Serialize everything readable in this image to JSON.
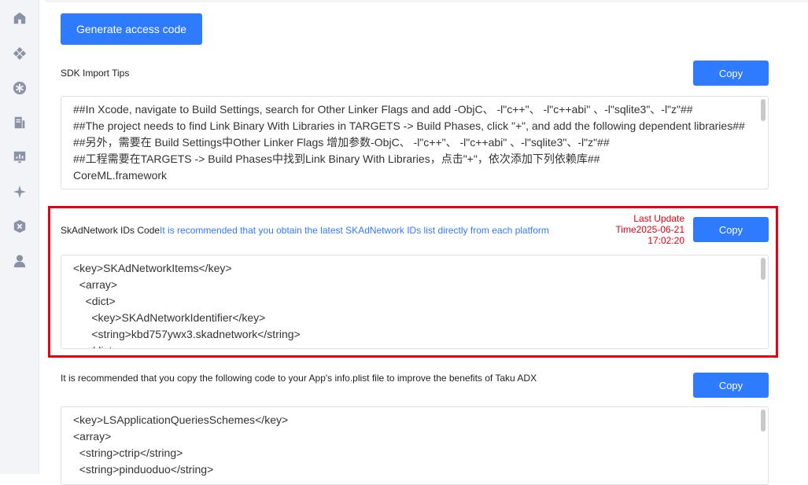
{
  "sidebar": {
    "icons": [
      "home-icon",
      "apps-icon",
      "asterisk-icon",
      "report-icon",
      "chart-icon",
      "sparkle-icon",
      "shield-icon",
      "user-icon"
    ]
  },
  "generate_button": "Generate access code",
  "sdk_tips": {
    "label": "SDK Import Tips",
    "copy": "Copy",
    "code": "##In Xcode, navigate to Build Settings, search for Other Linker Flags and add -ObjC、 -l\"c++\"、 -l\"c++abi\" 、-l\"sqlite3\"、-l\"z\"##\n##The project needs to find Link Binary With Libraries in TARGETS -> Build Phases, click \"+\", and add the following dependent libraries##\n##另外，需要在 Build Settings中Other Linker Flags 增加参数-ObjC、 -l\"c++\"、 -l\"c++abi\" 、-l\"sqlite3\"、-l\"z\"##\n##工程需要在TARGETS -> Build Phases中找到Link Binary With Libraries，点击\"+\"，依次添加下列依赖库##\nCoreML.framework"
  },
  "skadnetwork": {
    "label": "SkAdNetwork IDs Code",
    "hint": "It is recommended that you obtain the latest SKAdNetwork IDs list directly from each platform",
    "last_update_line1": "Last Update",
    "last_update_line2": "Time2025-06-21",
    "last_update_line3": "17:02:20",
    "copy": "Copy",
    "code": "<key>SKAdNetworkItems</key>\n  <array>\n    <dict>\n      <key>SKAdNetworkIdentifier</key>\n      <string>kbd757ywx3.skadnetwork</string>\n    </dict>"
  },
  "info_plist": {
    "label": "It is recommended that you copy the following code to your App's info.plist file to improve the benefits of Taku ADX",
    "copy": "Copy",
    "code": "<key>LSApplicationQueriesSchemes</key>\n<array>\n  <string>ctrip</string>\n  <string>pinduoduo</string>"
  },
  "colors": {
    "accent": "#2f7bff",
    "highlight": "#e60012"
  }
}
